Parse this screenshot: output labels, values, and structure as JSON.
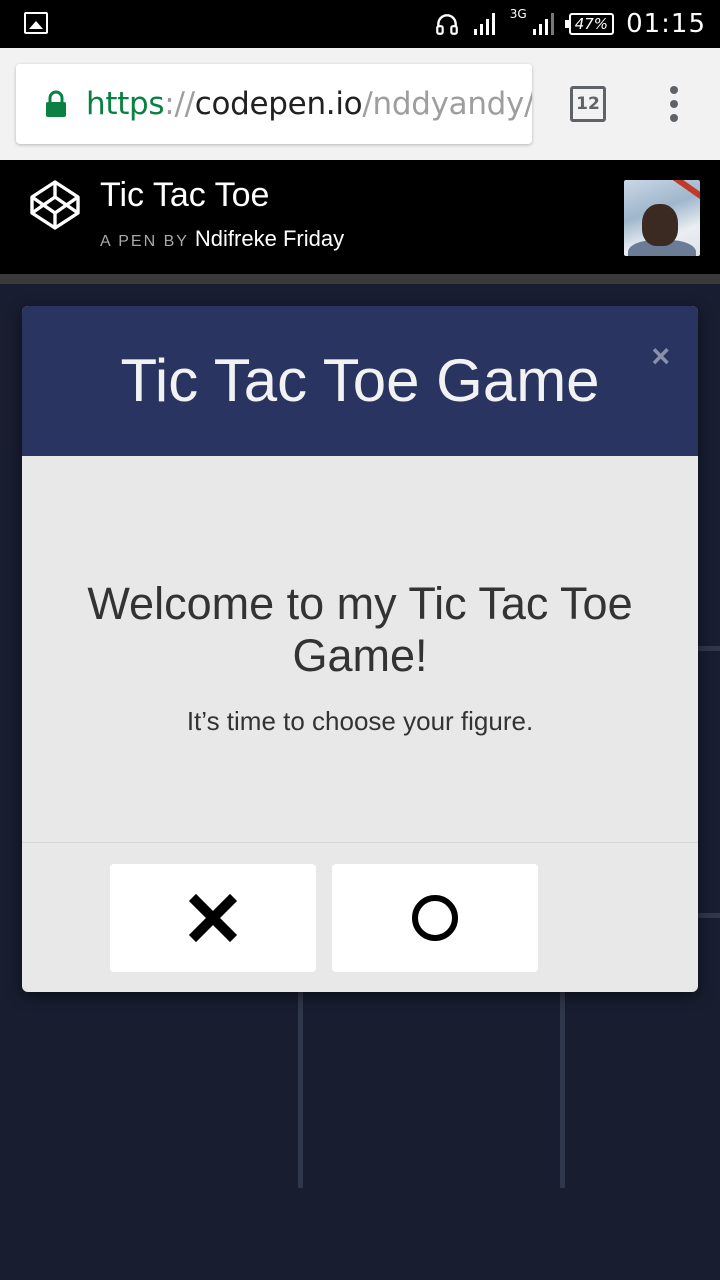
{
  "status_bar": {
    "network_type": "3G",
    "battery_percent": "47%",
    "time": "01:15",
    "icons": [
      "gallery-icon",
      "headphones-icon",
      "signal-icon",
      "battery-icon"
    ]
  },
  "browser": {
    "url_scheme": "https",
    "url_separator": "://",
    "url_host": "codepen.io",
    "url_path": "/nddyandy/t",
    "tab_count": "12",
    "accent_color": "#0b8043"
  },
  "codepen": {
    "pen_title": "Tic Tac Toe",
    "byline_prefix": "A PEN BY",
    "author": "Ndifreke Friday"
  },
  "modal": {
    "title": "Tic Tac Toe Game",
    "close_label": "×",
    "welcome": "Welcome to my Tic Tac Toe Game!",
    "subtitle": "It’s time to choose your figure.",
    "choices": [
      {
        "name": "x",
        "icon": "x-icon"
      },
      {
        "name": "o",
        "icon": "o-icon"
      }
    ],
    "header_color": "#2a3461",
    "body_color": "#e8e8e8"
  },
  "page_background": "#181d30"
}
